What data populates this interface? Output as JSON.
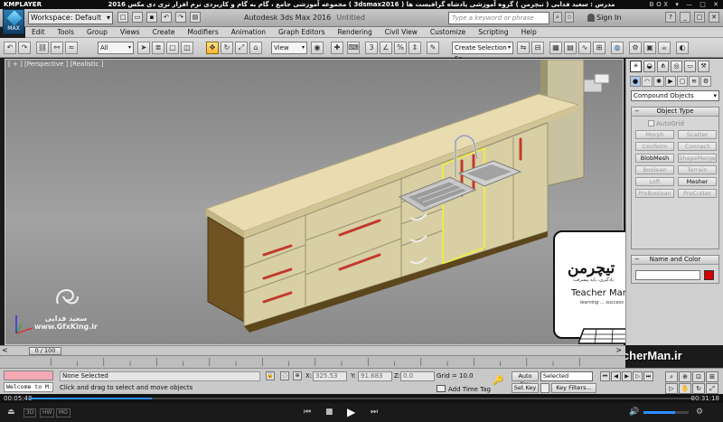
{
  "player": {
    "brand": "KMPLAYER",
    "window_buttons": "BOX ▾ — □ ✕",
    "overlay_title": "مجموعه آموزشی جامع ، گام به گام و کاربردی نرم افزار تری دی مکس 2016 ( 3dsmax2016 )   مدرس : سعید فدایی ( تیچرمن ) گروه آموزشی پادشاه گرافیست ها",
    "time_elapsed": "00:05:48",
    "time_total": "00:31:18",
    "progress_fraction": 0.185,
    "volume_fraction": 0.7,
    "controls": {
      "prev": "⏮",
      "stop": "■",
      "play": "▶",
      "next": "⏭",
      "eject": "⏏",
      "badge1": "3D",
      "badge2": "HW",
      "badge3": "MO"
    }
  },
  "app": {
    "logo_text": "MAX",
    "workspace": "Workspace: Default",
    "title": "Autodesk 3ds Max 2016",
    "file": "Untitled",
    "search_placeholder": "Type a keyword or phrase",
    "sign_in": "Sign In"
  },
  "menu": [
    "Edit",
    "Tools",
    "Group",
    "Views",
    "Create",
    "Modifiers",
    "Animation",
    "Graph Editors",
    "Rendering",
    "Civil View",
    "Customize",
    "Scripting",
    "Help"
  ],
  "toolbar": {
    "filter": "All",
    "refcoord": "View",
    "selection_set": "Create Selection Se"
  },
  "viewport": {
    "label": "[ + ] [Perspective ] [Realistic ]",
    "watermark_name": "سعید فدایی",
    "watermark_site": "www.GfxKing.ir"
  },
  "teacher": {
    "logo_fa": "تیچرمن",
    "logo_fa_sub": "یادگیری، پایه پیشرفت",
    "logo_en": "Teacher Man",
    "logo_en_sub": "learning ... success",
    "url": "www.TeacherMan.ir"
  },
  "command_panel": {
    "dropdown": "Compound Objects",
    "rollout_type": "Object Type",
    "autogrid": "AutoGrid",
    "buttons": [
      {
        "label": "Morph",
        "enabled": false
      },
      {
        "label": "Scatter",
        "enabled": false
      },
      {
        "label": "Conform",
        "enabled": false
      },
      {
        "label": "Connect",
        "enabled": false
      },
      {
        "label": "BlobMesh",
        "enabled": true
      },
      {
        "label": "ShapeMerge",
        "enabled": false
      },
      {
        "label": "Boolean",
        "enabled": false
      },
      {
        "label": "Terrain",
        "enabled": false
      },
      {
        "label": "Loft",
        "enabled": false
      },
      {
        "label": "Mesher",
        "enabled": true
      },
      {
        "label": "ProBoolean",
        "enabled": false
      },
      {
        "label": "ProCutter",
        "enabled": false
      }
    ],
    "rollout_name": "Name and Color",
    "object_color": "#d30000"
  },
  "time": {
    "slider": "0 / 100",
    "arrow_left": "<",
    "arrow_right": ">"
  },
  "status": {
    "welcome": "Welcome to M:",
    "selected": "None Selected",
    "prompt": "Click and drag to select and move objects",
    "x_label": "X:",
    "x_value": "325.53",
    "y_label": "Y:",
    "y_value": "91.683",
    "z_label": "Z:",
    "z_value": "0.0",
    "grid": "Grid = 10.0",
    "add_time_tag": "Add Time Tag",
    "auto_key": "Auto Key",
    "set_key": "Set Key",
    "selected_dd": "Selected",
    "key_filters": "Key Filters..."
  },
  "colors": {
    "selection_highlight": "#f5f03a",
    "cabinet": "#d8d0a4",
    "countertop": "#e8dcb0",
    "handle": "#c2392e"
  }
}
